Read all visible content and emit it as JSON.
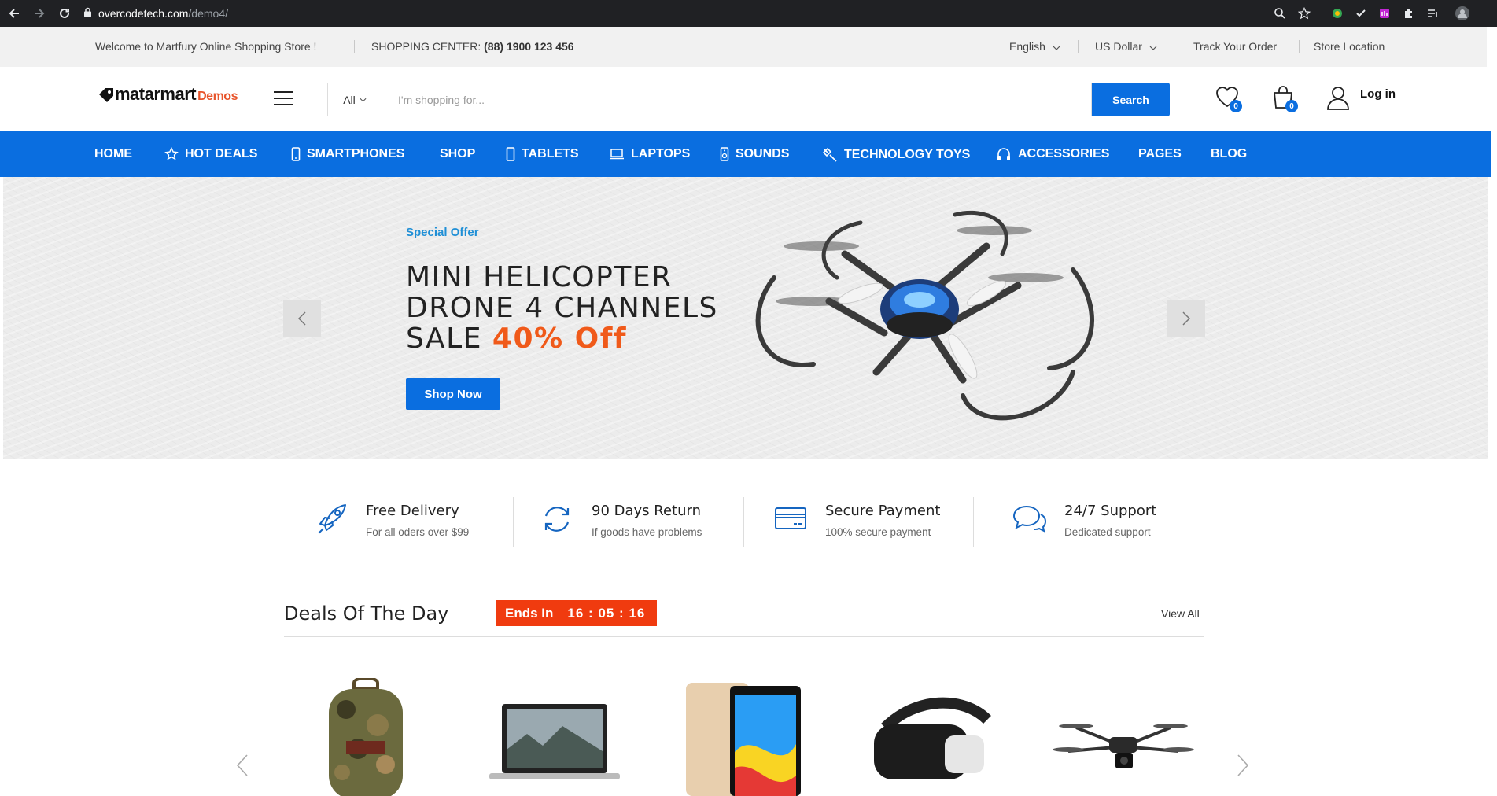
{
  "browser": {
    "url_host": "overcodetech.com",
    "url_path": "/demo4/"
  },
  "topbar": {
    "welcome": "Welcome to Martfury Online Shopping Store !",
    "center_label": "SHOPPING CENTER:",
    "center_phone": "(88) 1900 123 456",
    "language": "English",
    "currency": "US Dollar",
    "track": "Track Your Order",
    "store": "Store Location"
  },
  "header": {
    "logo_main": "matarmart",
    "logo_sub": "Demos",
    "search_category": "All",
    "search_placeholder": "I'm shopping for...",
    "search_button": "Search",
    "wishlist_count": "0",
    "cart_count": "0",
    "login": "Log in"
  },
  "nav": {
    "items": [
      {
        "label": "HOME"
      },
      {
        "label": "HOT DEALS"
      },
      {
        "label": "SMARTPHONES"
      },
      {
        "label": "SHOP"
      },
      {
        "label": "TABLETS"
      },
      {
        "label": "LAPTOPS"
      },
      {
        "label": "SOUNDS"
      },
      {
        "label": "TECHNOLOGY TOYS"
      },
      {
        "label": "ACCESSORIES"
      },
      {
        "label": "PAGES"
      },
      {
        "label": "BLOG"
      }
    ]
  },
  "hero": {
    "special": "Special Offer",
    "line1": "MINI HELICOPTER",
    "line2": "DRONE 4 CHANNELS",
    "line3_prefix": "SALE ",
    "line3_offer": "40% Off",
    "button": "Shop Now"
  },
  "features": [
    {
      "title": "Free Delivery",
      "sub": "For all oders over $99"
    },
    {
      "title": "90 Days Return",
      "sub": "If goods have problems"
    },
    {
      "title": "Secure Payment",
      "sub": "100% secure payment"
    },
    {
      "title": "24/7 Support",
      "sub": "Dedicated support"
    }
  ],
  "deals": {
    "title": "Deals Of The Day",
    "ends_label": "Ends In",
    "timer": "16 : 05 : 16",
    "view_all": "View All"
  },
  "colors": {
    "brand_blue": "#0a6ee0",
    "offer_orange": "#f05a1a",
    "ends_red": "#f03b0f"
  }
}
